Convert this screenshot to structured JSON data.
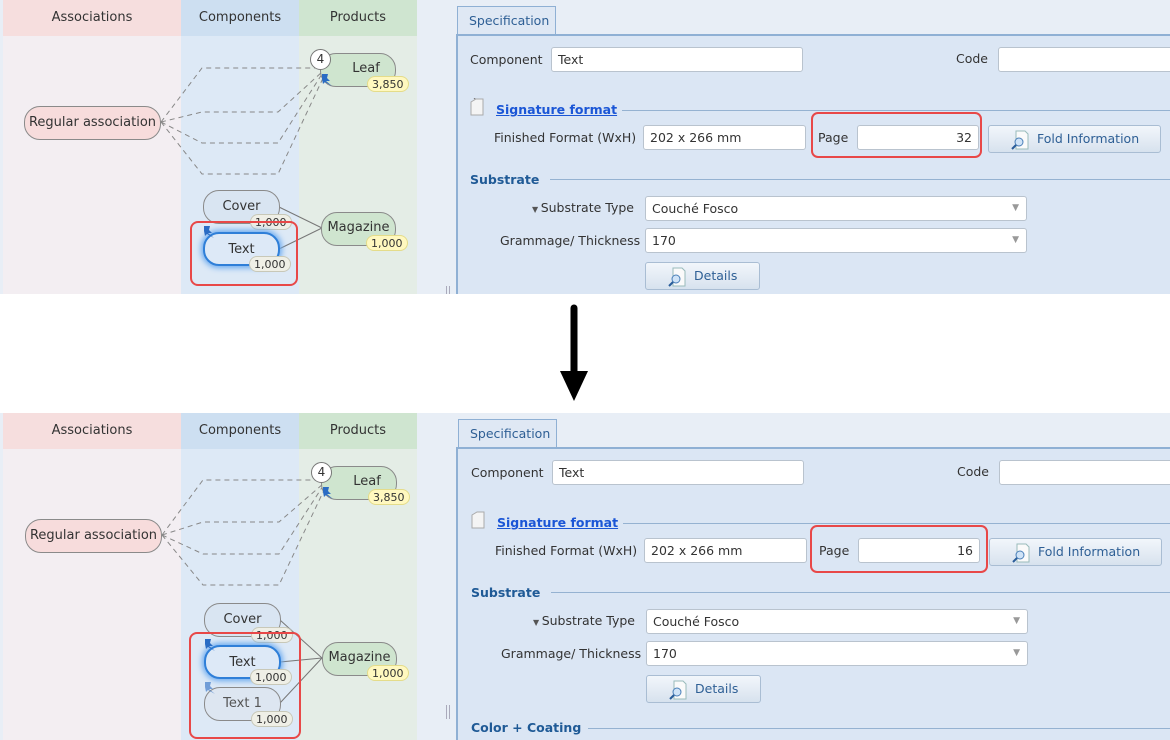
{
  "panels": [
    {
      "id": "before",
      "columns": {
        "associations": "Associations",
        "components": "Components",
        "products": "Products"
      },
      "association_node": "Regular association",
      "leaf": {
        "label": "Leaf",
        "count": "4",
        "quantity": "3,850"
      },
      "components": [
        {
          "label": "Cover",
          "quantity": "1,000",
          "state": "normal"
        },
        {
          "label": "Text",
          "quantity": "1,000",
          "state": "selected"
        }
      ],
      "product": {
        "label": "Magazine",
        "quantity": "1,000"
      },
      "form": {
        "tab": "Specification",
        "component_label": "Component",
        "component_value": "Text",
        "code_label": "Code",
        "code_value": "",
        "signature_section": "Signature format",
        "finished_format_label": "Finished Format (WxH)",
        "finished_format_value": "202 x 266 mm",
        "page_label": "Page",
        "page_value": "32",
        "fold_button": "Fold Information",
        "substrate_section": "Substrate",
        "substrate_type_label": "Substrate Type",
        "substrate_type_value": "Couché Fosco",
        "grammage_label": "Grammage/ Thickness",
        "grammage_value": "170",
        "details_button": "Details"
      }
    },
    {
      "id": "after",
      "columns": {
        "associations": "Associations",
        "components": "Components",
        "products": "Products"
      },
      "association_node": "Regular association",
      "leaf": {
        "label": "Leaf",
        "count": "4",
        "quantity": "3,850"
      },
      "components": [
        {
          "label": "Cover",
          "quantity": "1,000",
          "state": "normal"
        },
        {
          "label": "Text",
          "quantity": "1,000",
          "state": "selected"
        },
        {
          "label": "Text 1",
          "quantity": "1,000",
          "state": "faded"
        }
      ],
      "product": {
        "label": "Magazine",
        "quantity": "1,000"
      },
      "form": {
        "tab": "Specification",
        "component_label": "Component",
        "component_value": "Text",
        "code_label": "Code",
        "code_value": "",
        "signature_section": "Signature format",
        "finished_format_label": "Finished Format (WxH)",
        "finished_format_value": "202 x 266 mm",
        "page_label": "Page",
        "page_value": "16",
        "fold_button": "Fold Information",
        "substrate_section": "Substrate",
        "substrate_type_label": "Substrate Type",
        "substrate_type_value": "Couché Fosco",
        "grammage_label": "Grammage/ Thickness",
        "grammage_value": "170",
        "details_button": "Details",
        "color_section": "Color + Coating"
      }
    }
  ],
  "colors": {
    "highlight": "#e84848",
    "accent": "#1f5a96",
    "link": "#1b56d6"
  }
}
